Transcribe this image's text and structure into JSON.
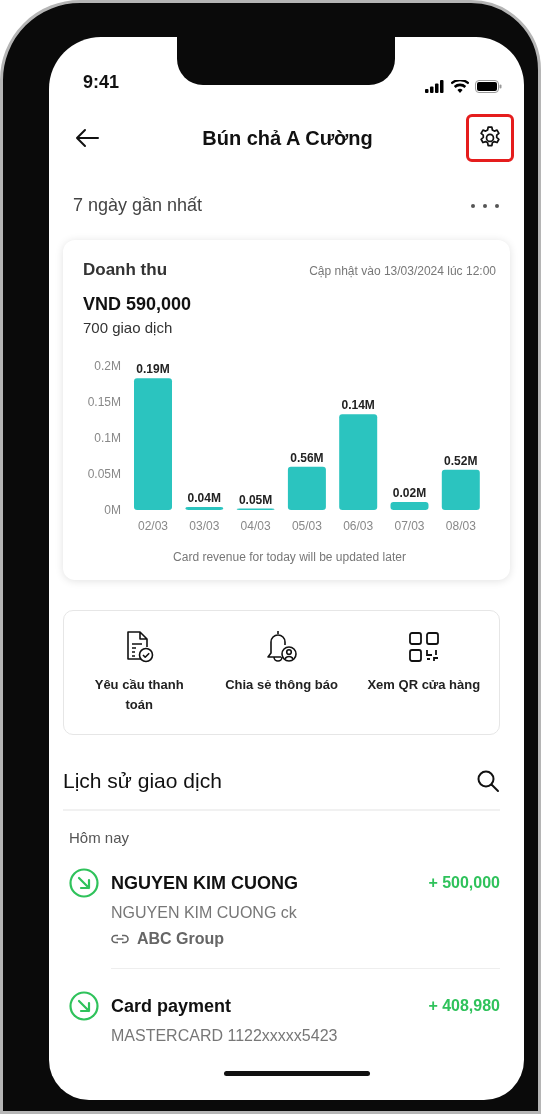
{
  "status_bar": {
    "time": "9:41"
  },
  "header": {
    "title": "Bún chả A Cường",
    "settings_highlighted": true
  },
  "period": {
    "label": "7 ngày gần nhất"
  },
  "revenue_card": {
    "title": "Doanh thu",
    "updated": "Cập nhật vào 13/03/2024 lúc 12:00",
    "total": "VND 590,000",
    "count": "700 giao dịch",
    "chart_data": {
      "type": "bar",
      "categories": [
        "02/03",
        "03/03",
        "04/03",
        "05/03",
        "06/03",
        "07/03",
        "08/03"
      ],
      "series": [
        {
          "color": "#2bc4bf",
          "values": [
            0.183,
            0.004,
            0.002,
            0.06,
            0.133,
            0.011,
            0.056
          ]
        }
      ],
      "ylim": [
        0,
        0.2
      ],
      "yticks": [
        {
          "value": 0,
          "label": "0M"
        },
        {
          "value": 0.05,
          "label": "0.05M"
        },
        {
          "value": 0.1,
          "label": "0.1M"
        },
        {
          "value": 0.15,
          "label": "0.15M"
        },
        {
          "value": 0.2,
          "label": "0.2M"
        }
      ],
      "value_labels": [
        "0.19M",
        "0.04M",
        "0.05M",
        "0.56M",
        "0.14M",
        "0.02M",
        "0.52M"
      ]
    },
    "note": "Card revenue for today will be updated later"
  },
  "actions": [
    {
      "kind": "invoice",
      "label": "Yêu cầu thanh toán"
    },
    {
      "kind": "bell",
      "label": "Chia sẻ thông báo"
    },
    {
      "kind": "qr",
      "label": "Xem QR cửa hàng"
    }
  ],
  "history": {
    "title": "Lịch sử giao dịch",
    "groups": [
      {
        "label": "Hôm nay",
        "transactions": [
          {
            "name": "NGUYEN KIM CUONG",
            "amount": "+ 500,000",
            "description": "NGUYEN KIM CUONG ck",
            "link": "ABC Group"
          },
          {
            "name": "Card payment",
            "amount": "+ 408,980",
            "description": "MASTERCARD 1122xxxxx5423"
          }
        ]
      }
    ]
  }
}
